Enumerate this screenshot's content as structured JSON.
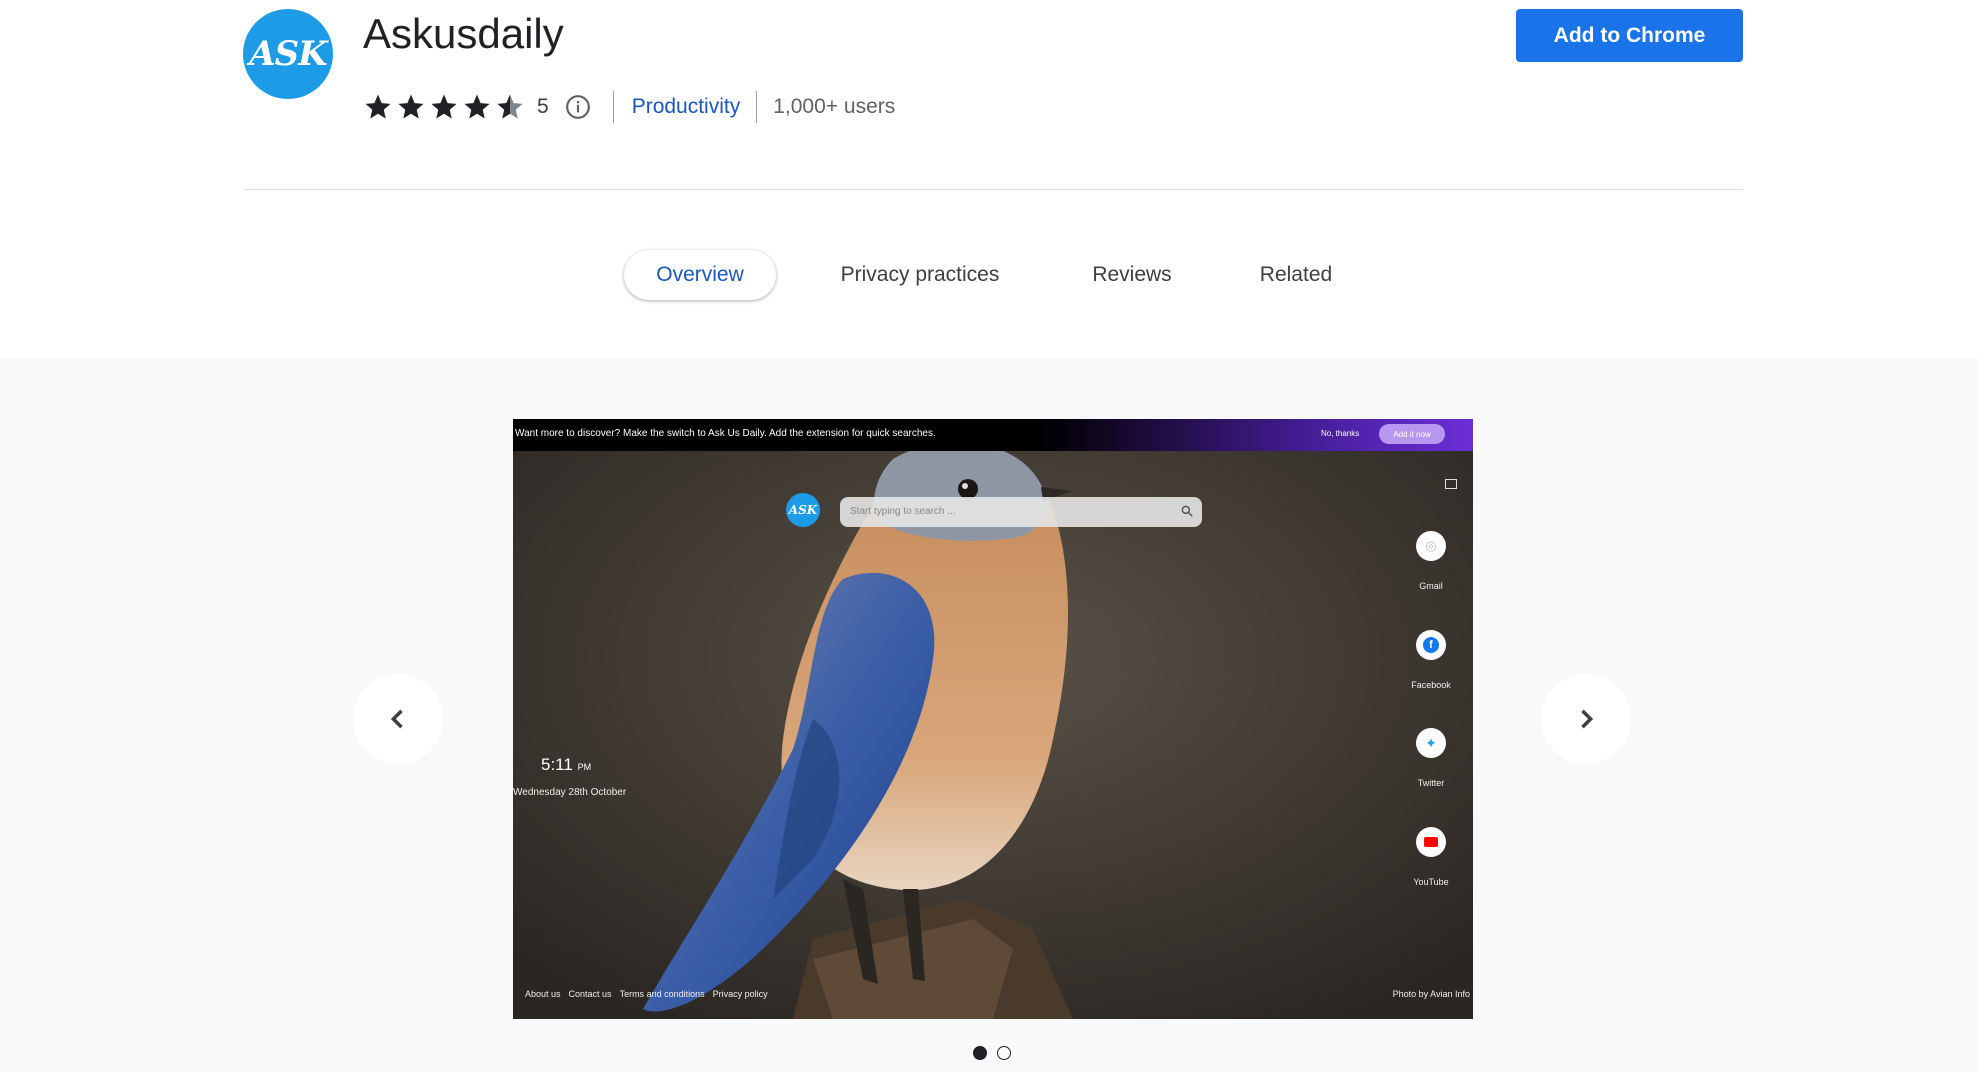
{
  "app": {
    "logo_text": "ASK",
    "title": "Askusdaily",
    "add_button_label": "Add to Chrome",
    "rating_value": 4.5,
    "rating_count": "5",
    "category": "Productivity",
    "users": "1,000+ users",
    "brand_color": "#1a73e8",
    "logo_color": "#1e9be6"
  },
  "tabs": [
    {
      "label": "Overview",
      "active": true
    },
    {
      "label": "Privacy practices",
      "active": false
    },
    {
      "label": "Reviews",
      "active": false
    },
    {
      "label": "Related",
      "active": false
    }
  ],
  "screenshot": {
    "banner_text": "Want more to discover? Make the switch to Ask Us Daily. Add the extension for quick searches.",
    "banner_no": "No, thanks",
    "banner_add": "Add it now",
    "logo_text": "ASK",
    "search_placeholder": "Start typing to search ...",
    "clock_time": "5:11",
    "clock_ampm": "PM",
    "date_text": "Wednesday 28th October",
    "social": [
      {
        "label": "Gmail",
        "icon": "gmail-icon"
      },
      {
        "label": "Facebook",
        "icon": "facebook-icon"
      },
      {
        "label": "Twitter",
        "icon": "twitter-icon"
      },
      {
        "label": "YouTube",
        "icon": "youtube-icon"
      }
    ],
    "footer_links": [
      "About us",
      "Contact us",
      "Terms and conditions",
      "Privacy policy"
    ],
    "photo_credit": "Photo by Avian Info"
  },
  "carousel": {
    "slide_count": 2,
    "current_slide": 1,
    "prev_icon": "chevron-left-icon",
    "next_icon": "chevron-right-icon"
  }
}
